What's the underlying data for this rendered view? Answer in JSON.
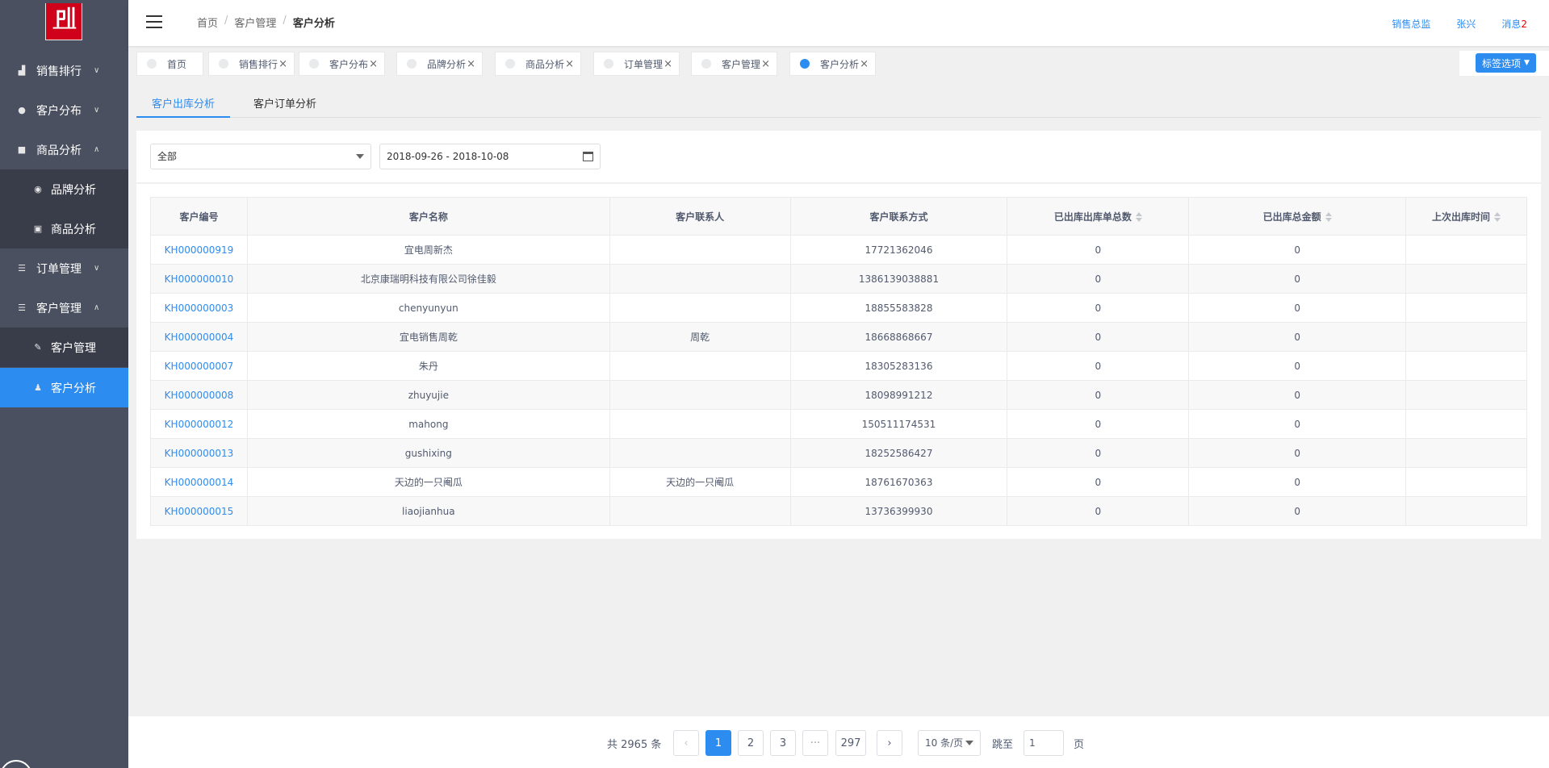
{
  "colors": {
    "sidebar_bg": "#4a5060",
    "accent": "#2d8cf0",
    "logo_red": "#d0021b",
    "badge": "#e00"
  },
  "logo": {
    "icon": "pll-logo-icon"
  },
  "sidebar": {
    "items": [
      {
        "label": "销售排行",
        "icon": "bar-chart-icon",
        "chevron": "∨"
      },
      {
        "label": "客户分布",
        "icon": "circle-icon",
        "chevron": "∨"
      },
      {
        "label": "商品分析",
        "icon": "square-icon",
        "chevron": "∧"
      },
      {
        "label": "品牌分析",
        "icon": "disc-icon"
      },
      {
        "label": "商品分析",
        "icon": "document-icon"
      },
      {
        "label": "订单管理",
        "icon": "list-icon",
        "chevron": "∨"
      },
      {
        "label": "客户管理",
        "icon": "list-icon",
        "chevron": "∧"
      },
      {
        "label": "客户管理",
        "icon": "edit-icon"
      },
      {
        "label": "客户分析",
        "icon": "users-icon"
      }
    ]
  },
  "header": {
    "breadcrumb": [
      "首页",
      "客户管理",
      "客户分析"
    ],
    "sep": "/",
    "right": {
      "role": "销售总监",
      "user": "张兴",
      "messages_label": "消息",
      "messages_count": "2"
    }
  },
  "tabs": {
    "items": [
      "首页",
      "销售排行",
      "客户分布",
      "品牌分析",
      "商品分析",
      "订单管理",
      "客户管理",
      "客户分析"
    ],
    "close": "×",
    "options_label": "标签选项"
  },
  "subtabs": [
    "客户出库分析",
    "客户订单分析"
  ],
  "filter": {
    "select_value": "全部",
    "date_range": "2018-09-26 - 2018-10-08"
  },
  "table": {
    "headers": [
      "客户编号",
      "客户名称",
      "客户联系人",
      "客户联系方式",
      "已出库出库单总数",
      "已出库总金额",
      "上次出库时间"
    ],
    "rows": [
      [
        "KH000000919",
        "宜电周新杰",
        "",
        "17721362046",
        "0",
        "0",
        ""
      ],
      [
        "KH000000010",
        "北京康瑞明科技有限公司徐佳毅",
        "",
        "1386139038881",
        "0",
        "0",
        ""
      ],
      [
        "KH000000003",
        "chenyunyun",
        "",
        "18855583828",
        "0",
        "0",
        ""
      ],
      [
        "KH000000004",
        "宜电销售周乾",
        "周乾",
        "18668868667",
        "0",
        "0",
        ""
      ],
      [
        "KH000000007",
        "朱丹",
        "",
        "18305283136",
        "0",
        "0",
        ""
      ],
      [
        "KH000000008",
        "zhuyujie",
        "",
        "18098991212",
        "0",
        "0",
        ""
      ],
      [
        "KH000000012",
        "mahong",
        "",
        "150511174531",
        "0",
        "0",
        ""
      ],
      [
        "KH000000013",
        "gushixing",
        "",
        "18252586427",
        "0",
        "0",
        ""
      ],
      [
        "KH000000014",
        "天边的一只阉瓜",
        "天边的一只阉瓜",
        "18761670363",
        "0",
        "0",
        ""
      ],
      [
        "KH000000015",
        "liaojianhua",
        "",
        "13736399930",
        "0",
        "0",
        ""
      ]
    ]
  },
  "pagination": {
    "total_text": "共 2965 条",
    "prev": "‹",
    "pages": [
      "1",
      "2",
      "3",
      "···",
      "297"
    ],
    "next": "›",
    "page_size": "10 条/页",
    "jump_label": "跳至",
    "jump_value": "1",
    "page_suffix": "页"
  }
}
